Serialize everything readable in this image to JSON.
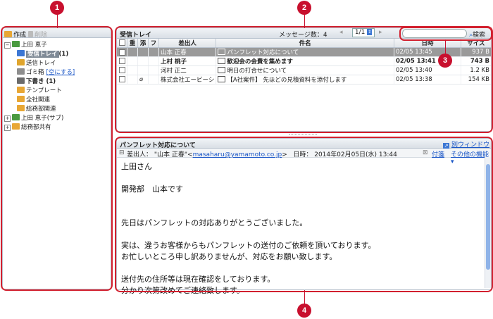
{
  "callouts": [
    "1",
    "2",
    "3",
    "4"
  ],
  "toolbar": {
    "create": "作成",
    "delete": "削除"
  },
  "tree": [
    {
      "label": "上田 恵子",
      "level": 0,
      "expander": "−",
      "bold": false
    },
    {
      "label": "受信トレイ",
      "count": "(1)",
      "level": 1,
      "bold": true,
      "selected": true
    },
    {
      "label": "送信トレイ",
      "level": 1,
      "bold": false
    },
    {
      "label": "ゴミ箱",
      "link": "[空にする]",
      "level": 1,
      "bold": false
    },
    {
      "label": "下書き (1)",
      "level": 1,
      "bold": true
    },
    {
      "label": "テンプレート",
      "level": 1,
      "bold": false
    },
    {
      "label": "全社関連",
      "level": 1,
      "bold": false
    },
    {
      "label": "総務部関連",
      "level": 1,
      "bold": false
    },
    {
      "label": "上田 恵子(サブ)",
      "level": 0,
      "expander": "+",
      "bold": false
    },
    {
      "label": "総務部共有",
      "level": 0,
      "expander": "+",
      "bold": false
    }
  ],
  "list": {
    "title": "受信トレイ",
    "message_count": "メッセージ数：4",
    "pager": "1/1",
    "search_button": "検索",
    "search_value": "",
    "headers": [
      "重",
      "添",
      "フ",
      "差出人",
      "件名",
      "日時",
      "サイズ"
    ],
    "rows": [
      {
        "checked": true,
        "attach": false,
        "from": "山本 正春",
        "subject": "パンフレット対応について",
        "date": "02/05 13:45",
        "size": "937 B",
        "selected": true,
        "bold": false,
        "icon": "open-mail-icon"
      },
      {
        "checked": false,
        "attach": false,
        "from": "上村 桃子",
        "subject": "歓迎会の会費を集めます",
        "date": "02/05 13:41",
        "size": "743 B",
        "selected": false,
        "bold": true,
        "icon": "closed-mail-icon"
      },
      {
        "checked": false,
        "attach": false,
        "from": "河村 正二",
        "subject": "明日の打合せについて",
        "date": "02/05 13:40",
        "size": "1.2 KB",
        "selected": false,
        "bold": false,
        "icon": "open-mail-icon"
      },
      {
        "checked": false,
        "attach": true,
        "from": "株式会社エービーシ",
        "subject": "【A社案件】 先ほどの見積資料を添付します",
        "date": "02/05 13:38",
        "size": "154 KB",
        "selected": false,
        "bold": false,
        "icon": "open-mail-icon"
      }
    ]
  },
  "preview": {
    "subject": "パンフレット対応について",
    "new_window": "別ウィンドウ",
    "from_label": "差出人：",
    "from_name": "\"山本 正春\"<",
    "from_email": "masaharu@yamamoto.co.jp",
    "from_end": ">",
    "date_label": "日時：",
    "date_value": "2014年02月05日(水) 13:44",
    "attach": "付箋",
    "other": "その他の機能",
    "body": [
      "上田さん",
      "",
      "開発部　山本です",
      "",
      "",
      "先日はパンフレットの対応ありがとうございました。",
      "",
      "実は、違うお客様からもパンフレットの送付のご依頼を頂いております。",
      "お忙しいところ申し訳ありませんが、対応をお願い致します。",
      "",
      "送付先の住所等は現在確認をしております。",
      "分かり次第改めてご連絡致します。"
    ]
  },
  "colors": {
    "callout": "#c8102e",
    "selected_row": "#9a9a9a",
    "link": "#1a56c7"
  }
}
